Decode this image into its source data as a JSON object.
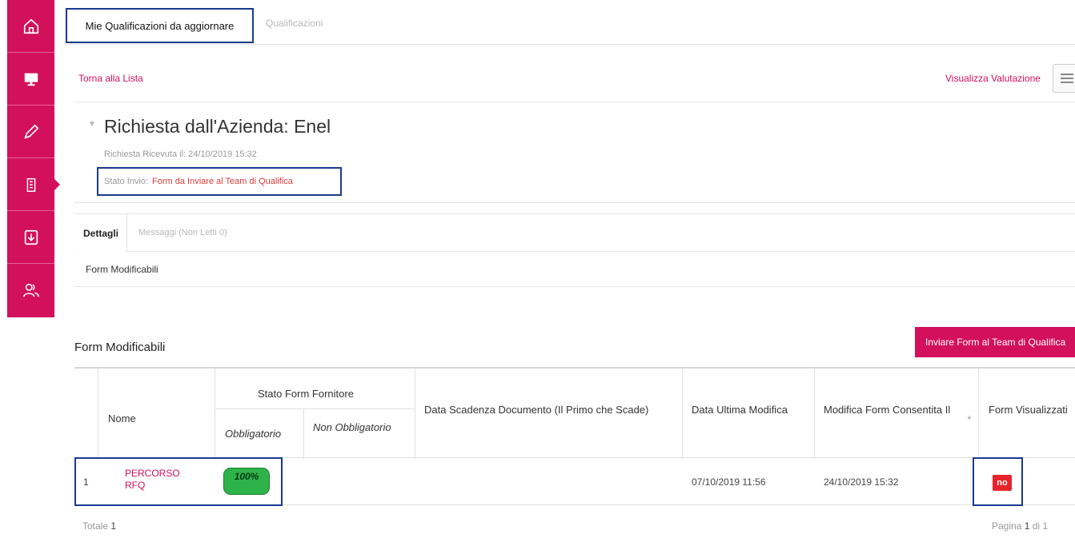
{
  "sidebar": {
    "accent": "#d3105c",
    "items": [
      {
        "icon": "home-icon"
      },
      {
        "icon": "monitor-icon"
      },
      {
        "icon": "pencil-icon"
      },
      {
        "icon": "building-icon",
        "active": true
      },
      {
        "icon": "download-icon"
      },
      {
        "icon": "users-icon"
      }
    ]
  },
  "tabs": {
    "active": "Mie Qualificazioni da aggiornare",
    "inactive": "Qualificazioni"
  },
  "links": {
    "back": "Torna alla Lista",
    "valuta": "Visualizza Valutazione"
  },
  "request": {
    "title": "Richiesta dall'Azienda: Enel",
    "received": "Richiesta Ricevuta il: 24/10/2019 15:32",
    "stato_label": "Stato Invio:",
    "stato_value": "Form da Inviare al Team di Qualifica"
  },
  "detail_tabs": {
    "active": "Dettagli",
    "inactive": "Messaggi (Non Letti 0)"
  },
  "form_modificabili_row": "Form Modificabili",
  "section_title": "Form Modificabili",
  "send_button": "Inviare Form al Team di Qualifica",
  "table": {
    "headers": {
      "nome": "Nome",
      "stato_group": "Stato Form Fornitore",
      "obbligatorio": "Obbligatorio",
      "non_obbligatorio": "Non Obbligatorio",
      "data_scadenza": "Data Scadenza Documento (Il Primo che Scade)",
      "data_ultima": "Data Ultima Modifica",
      "modifica_consentita": "Modifica Form Consentita Il",
      "form_visualizzati": "Form Visualizzati"
    },
    "rows": [
      {
        "index": "1",
        "nome": "PERCORSO RFQ",
        "obbligatorio": "100%",
        "obbligatorio_progress": 1.0,
        "non_obbligatorio": "",
        "data_scadenza": "",
        "data_ultima": "07/10/2019 11:56",
        "modifica_consentita": "24/10/2019 15:32",
        "form_visualizzati": "no"
      }
    ]
  },
  "footer": {
    "totale_label": "Totale",
    "totale_value": "1",
    "pagina_label": "Pagina",
    "pagina_current": "1",
    "pagina_sep": "di",
    "pagina_total": "1"
  },
  "colors": {
    "accent": "#d3105c",
    "annotation": "#1a3a8f",
    "success": "#2eb34a",
    "danger": "#e8232a"
  }
}
